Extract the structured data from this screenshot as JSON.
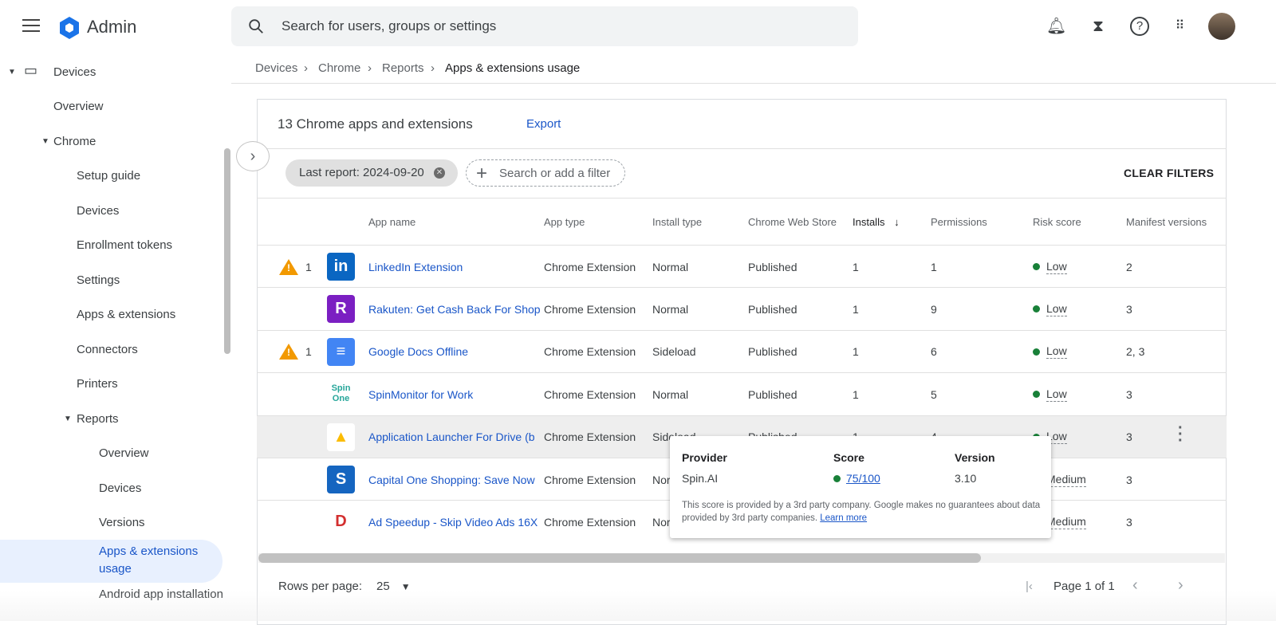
{
  "header": {
    "brand": "Admin",
    "search_placeholder": "Search for users, groups or settings"
  },
  "sidebar": {
    "items": [
      {
        "label": "Devices"
      },
      {
        "label": "Overview"
      },
      {
        "label": "Chrome"
      },
      {
        "label": "Setup guide"
      },
      {
        "label": "Devices"
      },
      {
        "label": "Enrollment tokens"
      },
      {
        "label": "Settings"
      },
      {
        "label": "Apps & extensions"
      },
      {
        "label": "Connectors"
      },
      {
        "label": "Printers"
      },
      {
        "label": "Reports"
      },
      {
        "label": "Overview"
      },
      {
        "label": "Devices"
      },
      {
        "label": "Versions"
      },
      {
        "label": "Apps & extensions usage"
      },
      {
        "label": "Android app installation"
      }
    ]
  },
  "breadcrumb": [
    "Devices",
    "Chrome",
    "Reports",
    "Apps & extensions usage"
  ],
  "card": {
    "title": "13 Chrome apps and extensions",
    "export": "Export",
    "filter_chip": "Last report: 2024-09-20",
    "filter_placeholder": "Search or add a filter",
    "clear_filters": "CLEAR FILTERS"
  },
  "table": {
    "columns": [
      "App name",
      "App type",
      "Install type",
      "Chrome Web Store",
      "Installs",
      "Permissions",
      "Risk score",
      "Manifest versions"
    ],
    "rows": [
      {
        "warn": "1",
        "name": "LinkedIn Extension",
        "type": "Chrome Extension",
        "install": "Normal",
        "store": "Published",
        "installs": "1",
        "perms": "1",
        "risk": "Low",
        "manifest": "2",
        "icon": "in",
        "color": "#0a66c2"
      },
      {
        "warn": "",
        "name": "Rakuten: Get Cash Back For Shop",
        "type": "Chrome Extension",
        "install": "Normal",
        "store": "Published",
        "installs": "1",
        "perms": "9",
        "risk": "Low",
        "manifest": "3",
        "icon": "R",
        "color": "#7b1fc2"
      },
      {
        "warn": "1",
        "name": "Google Docs Offline",
        "type": "Chrome Extension",
        "install": "Sideload",
        "store": "Published",
        "installs": "1",
        "perms": "6",
        "risk": "Low",
        "manifest": "2, 3",
        "icon": "≡",
        "color": "#4285f4"
      },
      {
        "warn": "",
        "name": "SpinMonitor for Work",
        "type": "Chrome Extension",
        "install": "Normal",
        "store": "Published",
        "installs": "1",
        "perms": "5",
        "risk": "Low",
        "manifest": "3",
        "icon": "Spin One",
        "color": "#ffffff"
      },
      {
        "warn": "",
        "name": "Application Launcher For Drive (b",
        "type": "Chrome Extension",
        "install": "Sideload",
        "store": "Published",
        "installs": "1",
        "perms": "4",
        "risk": "Low",
        "manifest": "3",
        "icon": "▲",
        "color": "#ffffff"
      },
      {
        "warn": "",
        "name": "Capital One Shopping: Save Now",
        "type": "Chrome Extension",
        "install": "Normal",
        "store": "",
        "installs": "",
        "perms": "",
        "risk": "Medium",
        "manifest": "3",
        "icon": "S",
        "color": "#1565c0"
      },
      {
        "warn": "",
        "name": "Ad Speedup - Skip Video Ads 16X",
        "type": "Chrome Extension",
        "install": "Normal",
        "store": "",
        "installs": "",
        "perms": "",
        "risk": "Medium",
        "manifest": "3",
        "icon": "D",
        "color": "#ffffff"
      }
    ]
  },
  "tooltip": {
    "provider_label": "Provider",
    "score_label": "Score",
    "version_label": "Version",
    "provider": "Spin.AI",
    "score": "75/100",
    "version": "3.10",
    "note": "This score is provided by a 3rd party company. Google makes no guarantees about data provided by 3rd party companies.",
    "learn_more": "Learn more"
  },
  "footer": {
    "rows_label": "Rows per page:",
    "rows_value": "25",
    "page": "Page 1 of 1"
  }
}
